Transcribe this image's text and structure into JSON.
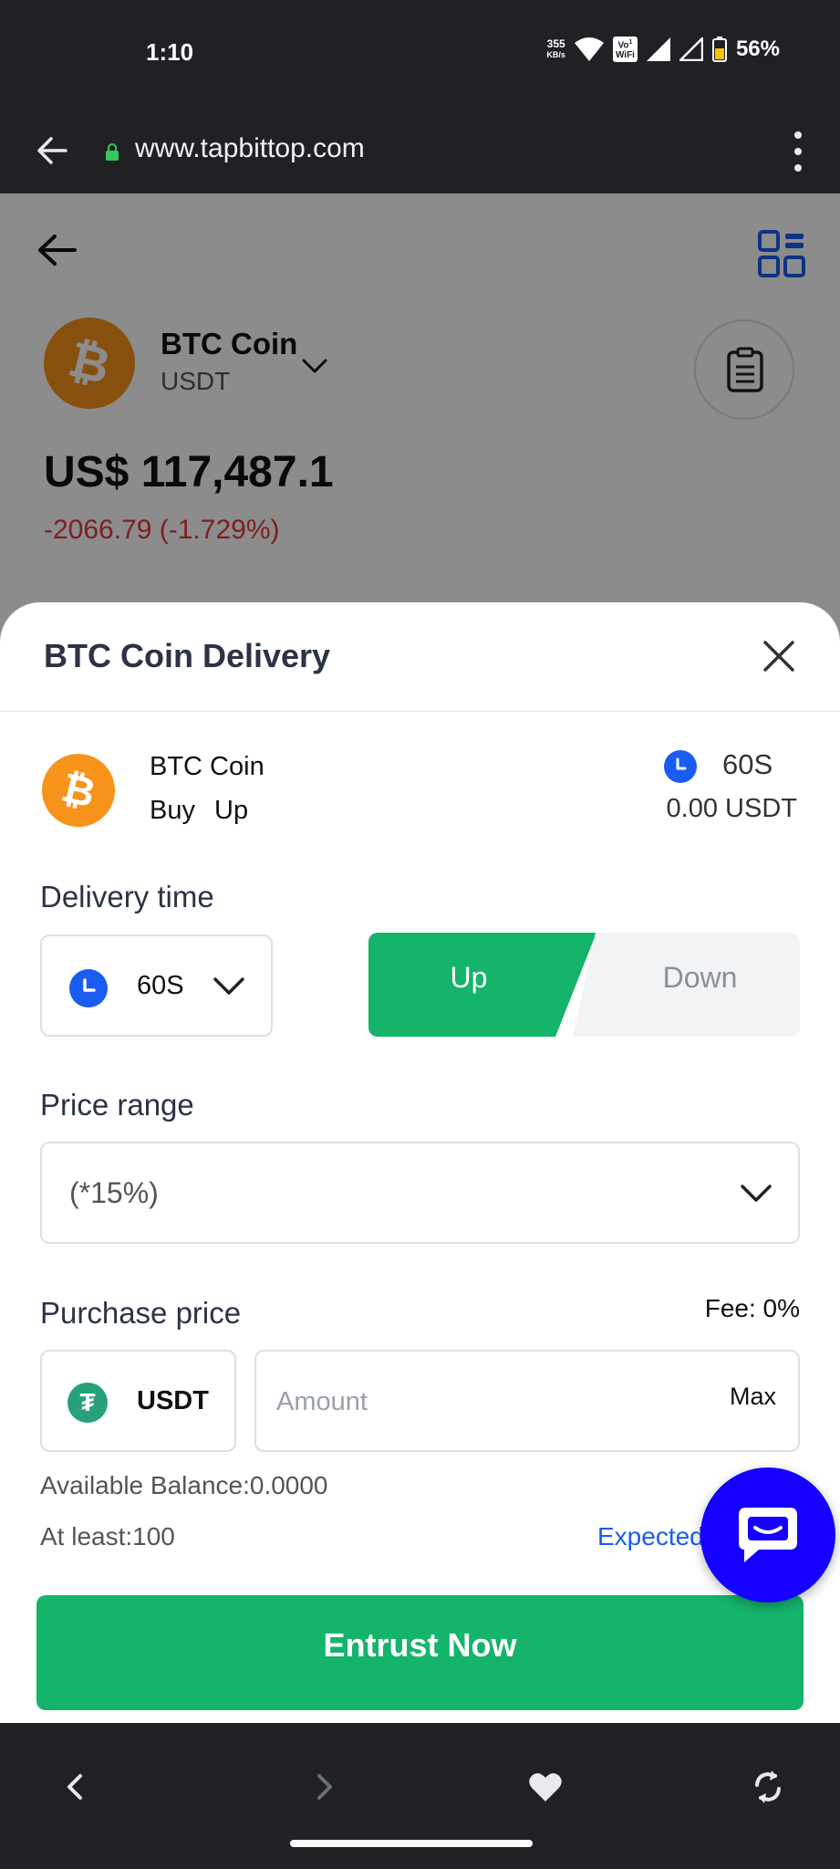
{
  "status_bar": {
    "time": "1:10",
    "net_speed_value": "355",
    "net_speed_unit": "KB/s",
    "volte_top": "Vo",
    "volte_bottom": "WiFi",
    "volte_sup": "1",
    "battery": "56%",
    "icons": [
      "wifi-icon",
      "signal-icon",
      "signal-icon",
      "battery-icon"
    ]
  },
  "browser": {
    "url": "www.tapbittop.com"
  },
  "header": {
    "coin_name": "BTC Coin",
    "coin_quote": "USDT",
    "price": "US$ 117,487.1",
    "change": "-2066.79 (-1.729%)"
  },
  "sheet": {
    "title": "BTC Coin Delivery",
    "summary": {
      "coin": "BTC Coin",
      "side": "Buy",
      "direction": "Up",
      "time": "60S",
      "amount": "0.00 USDT"
    },
    "delivery_label": "Delivery time",
    "delivery_value": "60S",
    "up_label": "Up",
    "down_label": "Down",
    "range_label": "Price range",
    "range_value": "(*15%)",
    "purchase_label": "Purchase price",
    "fee": "Fee: 0%",
    "currency": "USDT",
    "amount_placeholder": "Amount",
    "max_label": "Max",
    "balance": "Available Balance:0.0000",
    "at_least": "At least:100",
    "expected": "Expected",
    "submit_label": "Entrust Now"
  },
  "colors": {
    "accent_green": "#14b46b",
    "accent_blue": "#1a5cf0",
    "negative": "#e53935",
    "btc_orange": "#f7931a",
    "chat_blue": "#1500ff"
  }
}
